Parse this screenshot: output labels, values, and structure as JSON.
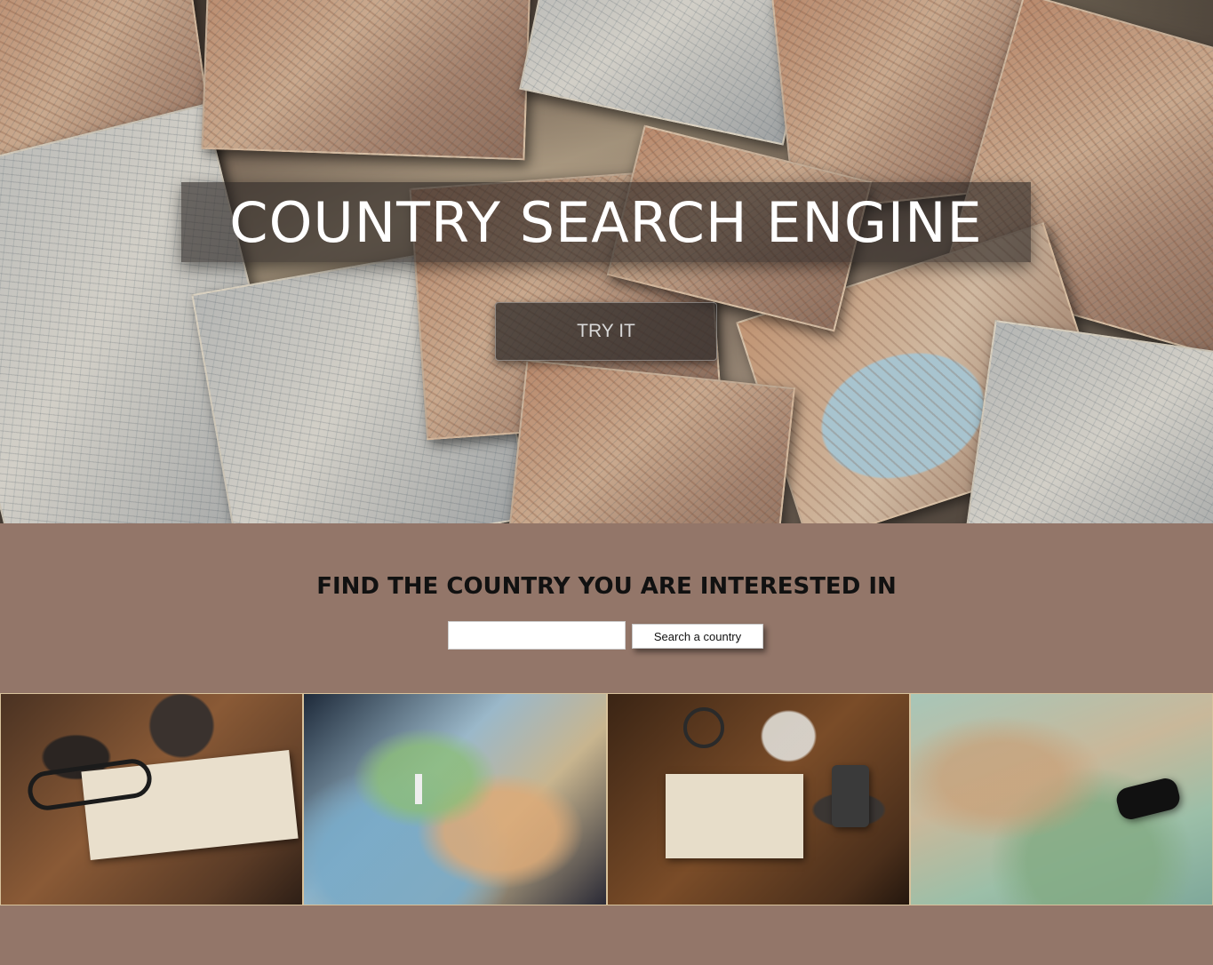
{
  "hero": {
    "title": "COUNTRY SEARCH ENGINE",
    "try_button_label": "TRY IT",
    "background_image": "scattered-vintage-maps"
  },
  "search": {
    "heading": "FIND THE COUNTRY YOU ARE INTERESTED IN",
    "input_value": "",
    "button_label": "Search a country"
  },
  "gallery": {
    "images": [
      "notebook-glasses-camera-photo",
      "miniature-traveler-on-map-photo",
      "notebook-magnifier-camera-photo",
      "toy-car-on-map-photo"
    ]
  },
  "colors": {
    "page_background": "#937669",
    "gallery_border": "#d8c29c",
    "hero_title_text": "#ffffff"
  }
}
